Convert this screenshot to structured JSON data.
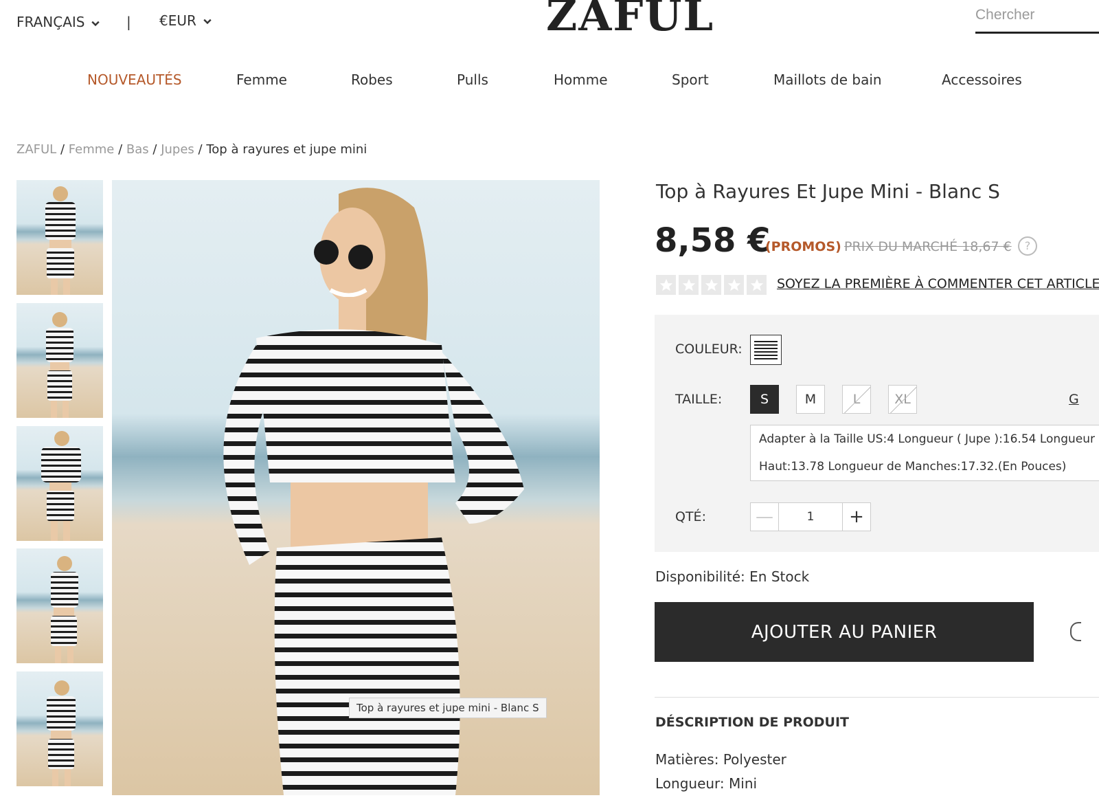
{
  "header": {
    "language": "FRANÇAIS",
    "separator": "|",
    "currency": "€EUR",
    "logo": "ZAFUL",
    "search_placeholder": "Chercher"
  },
  "nav": {
    "items": [
      "NOUVEAUTÉS",
      "Femme",
      "Robes",
      "Pulls",
      "Homme",
      "Sport",
      "Maillots de bain",
      "Accessoires"
    ],
    "active_color": "#b5592a"
  },
  "breadcrumb": {
    "items": [
      "ZAFUL",
      "Femme",
      "Bas",
      "Jupes",
      "Top à rayures et jupe mini"
    ],
    "separator": "/"
  },
  "gallery": {
    "thumbnail_count": 5,
    "caption": "Top à rayures et jupe mini - Blanc S"
  },
  "product": {
    "title": "Top à Rayures Et Jupe Mini - Blanc S",
    "price": "8,58 €",
    "promo_label": "(PROMOS)",
    "market_price": "PRIX DU MARCHÉ 18,67 €",
    "help_icon": "?",
    "rating_stars": 5,
    "review_link": "SOYEZ LA PREMIÈRE À COMMENTER CET ARTICLE",
    "color_label": "COULEUR:",
    "size_label": "TAILLE:",
    "sizes": [
      {
        "label": "S",
        "state": "selected"
      },
      {
        "label": "M",
        "state": "available"
      },
      {
        "label": "L",
        "state": "unavailable"
      },
      {
        "label": "XL",
        "state": "unavailable"
      }
    ],
    "size_guide_link": "G",
    "size_info_line1": "Adapter à la Taille US:4   Longueur ( Jupe ):16.54   Longueur",
    "size_info_line2": "Haut:13.78   Longueur de Manches:17.32.(En Pouces)",
    "qty_label": "QTÉ:",
    "qty_value": "1",
    "qty_minus": "—",
    "qty_plus": "+",
    "availability": "Disponibilité: En Stock",
    "add_to_cart": "AJOUTER AU PANIER",
    "description_heading": "DÉSCRIPTION DE PRODUIT",
    "description": [
      "Matières: Polyester",
      "Longueur: Mini"
    ],
    "accent_color": "#b5592a",
    "button_color": "#2b2b2b"
  }
}
